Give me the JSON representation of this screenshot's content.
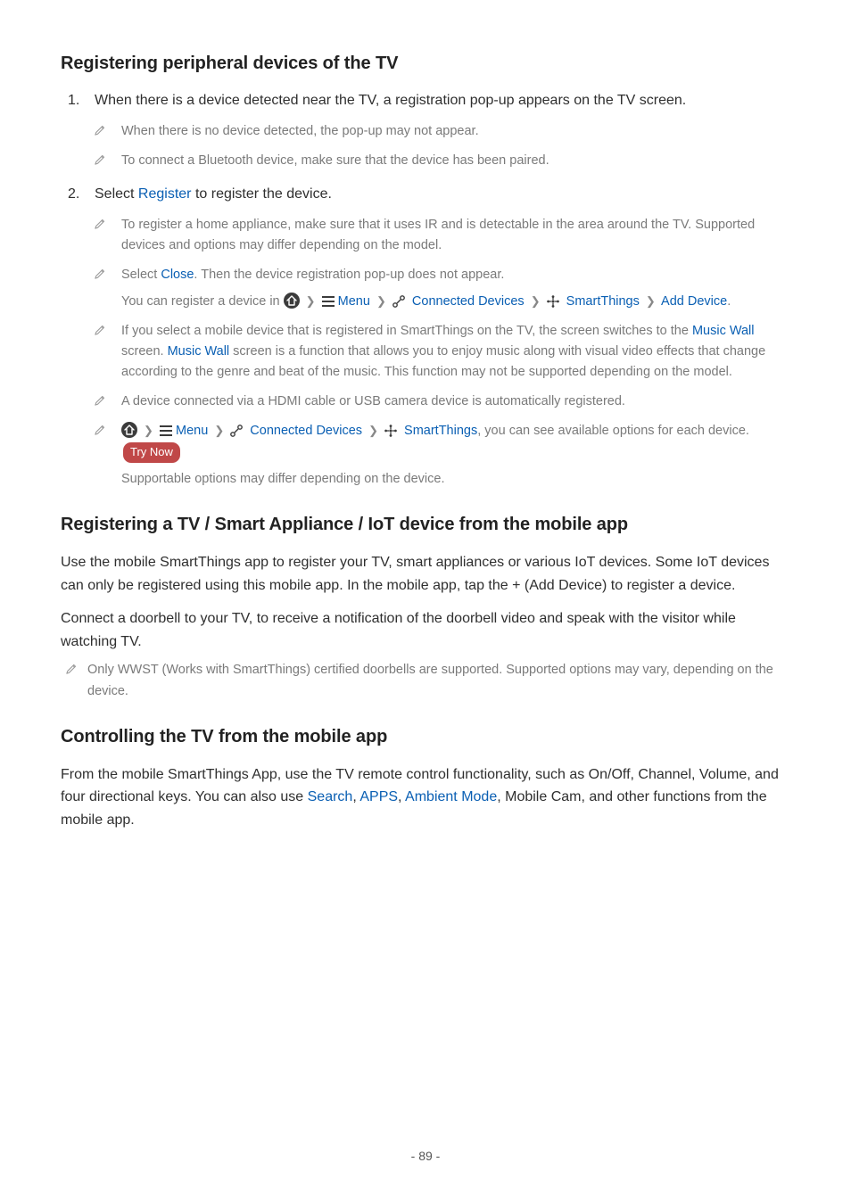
{
  "s1": {
    "heading": "Registering peripheral devices of the TV",
    "item1": {
      "text": "When there is a device detected near the TV, a registration pop-up appears on the TV screen.",
      "n1": "When there is no device detected, the pop-up may not appear.",
      "n2": "To connect a Bluetooth device, make sure that the device has been paired."
    },
    "item2": {
      "pre": "Select ",
      "register": "Register",
      "post": " to register the device.",
      "n1": "To register a home appliance, make sure that it uses IR and is detectable in the area around the TV. Supported devices and options may differ depending on the model.",
      "n2a": "Select ",
      "close": "Close",
      "n2b": ". Then the device registration pop-up does not appear.",
      "n2c_pre": "You can register a device in ",
      "menu": "Menu",
      "conn": "Connected Devices",
      "st": "SmartThings",
      "add": "Add Device",
      "n3a": "If you select a mobile device that is registered in SmartThings on the TV, the screen switches to the ",
      "mw": "Music Wall",
      "n3b": " screen. ",
      "n3c": " screen is a function that allows you to enjoy music along with visual video effects that change according to the genre and beat of the music. This function may not be supported depending on the model.",
      "n4": "A device connected via a HDMI cable or USB camera device is automatically registered.",
      "n5a": ", you can see available options for each device.",
      "try": "Try Now",
      "n5b": "Supportable options may differ depending on the device."
    }
  },
  "s2": {
    "heading": "Registering a TV / Smart Appliance / IoT device from the mobile app",
    "p1": "Use the mobile SmartThings app to register your TV, smart appliances or various IoT devices. Some IoT devices can only be registered using this mobile app. In the mobile app, tap the + (Add Device) to register a device.",
    "p2": "Connect a doorbell to your TV, to receive a notification of the doorbell video and speak with the visitor while watching TV.",
    "n1": "Only WWST (Works with SmartThings) certified doorbells are supported. Supported options may vary, depending on the device."
  },
  "s3": {
    "heading": "Controlling the TV from the mobile app",
    "p1a": "From the mobile SmartThings App, use the TV remote control functionality, such as On/Off, Channel, Volume, and four directional keys. You can also use ",
    "search": "Search",
    "c1": ", ",
    "apps": "APPS",
    "c2": ", ",
    "ambient": "Ambient Mode",
    "p1b": ", Mobile Cam, and other functions from the mobile app."
  },
  "footer": "- 89 -"
}
